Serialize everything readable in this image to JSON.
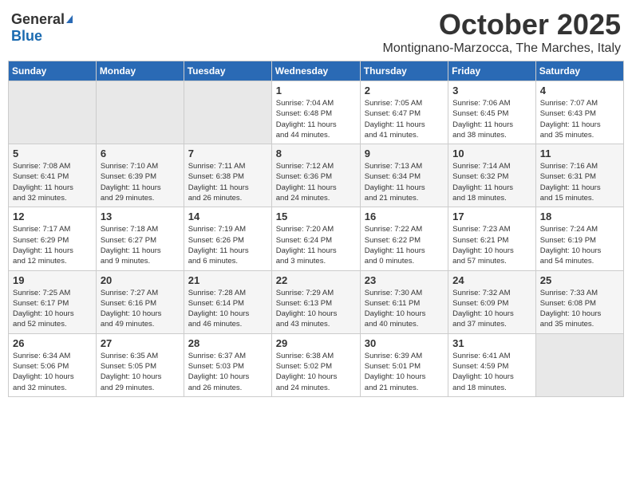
{
  "logo": {
    "general": "General",
    "blue": "Blue"
  },
  "title": "October 2025",
  "subtitle": "Montignano-Marzocca, The Marches, Italy",
  "days_header": [
    "Sunday",
    "Monday",
    "Tuesday",
    "Wednesday",
    "Thursday",
    "Friday",
    "Saturday"
  ],
  "weeks": [
    [
      {
        "day": "",
        "info": ""
      },
      {
        "day": "",
        "info": ""
      },
      {
        "day": "",
        "info": ""
      },
      {
        "day": "1",
        "info": "Sunrise: 7:04 AM\nSunset: 6:48 PM\nDaylight: 11 hours\nand 44 minutes."
      },
      {
        "day": "2",
        "info": "Sunrise: 7:05 AM\nSunset: 6:47 PM\nDaylight: 11 hours\nand 41 minutes."
      },
      {
        "day": "3",
        "info": "Sunrise: 7:06 AM\nSunset: 6:45 PM\nDaylight: 11 hours\nand 38 minutes."
      },
      {
        "day": "4",
        "info": "Sunrise: 7:07 AM\nSunset: 6:43 PM\nDaylight: 11 hours\nand 35 minutes."
      }
    ],
    [
      {
        "day": "5",
        "info": "Sunrise: 7:08 AM\nSunset: 6:41 PM\nDaylight: 11 hours\nand 32 minutes."
      },
      {
        "day": "6",
        "info": "Sunrise: 7:10 AM\nSunset: 6:39 PM\nDaylight: 11 hours\nand 29 minutes."
      },
      {
        "day": "7",
        "info": "Sunrise: 7:11 AM\nSunset: 6:38 PM\nDaylight: 11 hours\nand 26 minutes."
      },
      {
        "day": "8",
        "info": "Sunrise: 7:12 AM\nSunset: 6:36 PM\nDaylight: 11 hours\nand 24 minutes."
      },
      {
        "day": "9",
        "info": "Sunrise: 7:13 AM\nSunset: 6:34 PM\nDaylight: 11 hours\nand 21 minutes."
      },
      {
        "day": "10",
        "info": "Sunrise: 7:14 AM\nSunset: 6:32 PM\nDaylight: 11 hours\nand 18 minutes."
      },
      {
        "day": "11",
        "info": "Sunrise: 7:16 AM\nSunset: 6:31 PM\nDaylight: 11 hours\nand 15 minutes."
      }
    ],
    [
      {
        "day": "12",
        "info": "Sunrise: 7:17 AM\nSunset: 6:29 PM\nDaylight: 11 hours\nand 12 minutes."
      },
      {
        "day": "13",
        "info": "Sunrise: 7:18 AM\nSunset: 6:27 PM\nDaylight: 11 hours\nand 9 minutes."
      },
      {
        "day": "14",
        "info": "Sunrise: 7:19 AM\nSunset: 6:26 PM\nDaylight: 11 hours\nand 6 minutes."
      },
      {
        "day": "15",
        "info": "Sunrise: 7:20 AM\nSunset: 6:24 PM\nDaylight: 11 hours\nand 3 minutes."
      },
      {
        "day": "16",
        "info": "Sunrise: 7:22 AM\nSunset: 6:22 PM\nDaylight: 11 hours\nand 0 minutes."
      },
      {
        "day": "17",
        "info": "Sunrise: 7:23 AM\nSunset: 6:21 PM\nDaylight: 10 hours\nand 57 minutes."
      },
      {
        "day": "18",
        "info": "Sunrise: 7:24 AM\nSunset: 6:19 PM\nDaylight: 10 hours\nand 54 minutes."
      }
    ],
    [
      {
        "day": "19",
        "info": "Sunrise: 7:25 AM\nSunset: 6:17 PM\nDaylight: 10 hours\nand 52 minutes."
      },
      {
        "day": "20",
        "info": "Sunrise: 7:27 AM\nSunset: 6:16 PM\nDaylight: 10 hours\nand 49 minutes."
      },
      {
        "day": "21",
        "info": "Sunrise: 7:28 AM\nSunset: 6:14 PM\nDaylight: 10 hours\nand 46 minutes."
      },
      {
        "day": "22",
        "info": "Sunrise: 7:29 AM\nSunset: 6:13 PM\nDaylight: 10 hours\nand 43 minutes."
      },
      {
        "day": "23",
        "info": "Sunrise: 7:30 AM\nSunset: 6:11 PM\nDaylight: 10 hours\nand 40 minutes."
      },
      {
        "day": "24",
        "info": "Sunrise: 7:32 AM\nSunset: 6:09 PM\nDaylight: 10 hours\nand 37 minutes."
      },
      {
        "day": "25",
        "info": "Sunrise: 7:33 AM\nSunset: 6:08 PM\nDaylight: 10 hours\nand 35 minutes."
      }
    ],
    [
      {
        "day": "26",
        "info": "Sunrise: 6:34 AM\nSunset: 5:06 PM\nDaylight: 10 hours\nand 32 minutes."
      },
      {
        "day": "27",
        "info": "Sunrise: 6:35 AM\nSunset: 5:05 PM\nDaylight: 10 hours\nand 29 minutes."
      },
      {
        "day": "28",
        "info": "Sunrise: 6:37 AM\nSunset: 5:03 PM\nDaylight: 10 hours\nand 26 minutes."
      },
      {
        "day": "29",
        "info": "Sunrise: 6:38 AM\nSunset: 5:02 PM\nDaylight: 10 hours\nand 24 minutes."
      },
      {
        "day": "30",
        "info": "Sunrise: 6:39 AM\nSunset: 5:01 PM\nDaylight: 10 hours\nand 21 minutes."
      },
      {
        "day": "31",
        "info": "Sunrise: 6:41 AM\nSunset: 4:59 PM\nDaylight: 10 hours\nand 18 minutes."
      },
      {
        "day": "",
        "info": ""
      }
    ]
  ]
}
